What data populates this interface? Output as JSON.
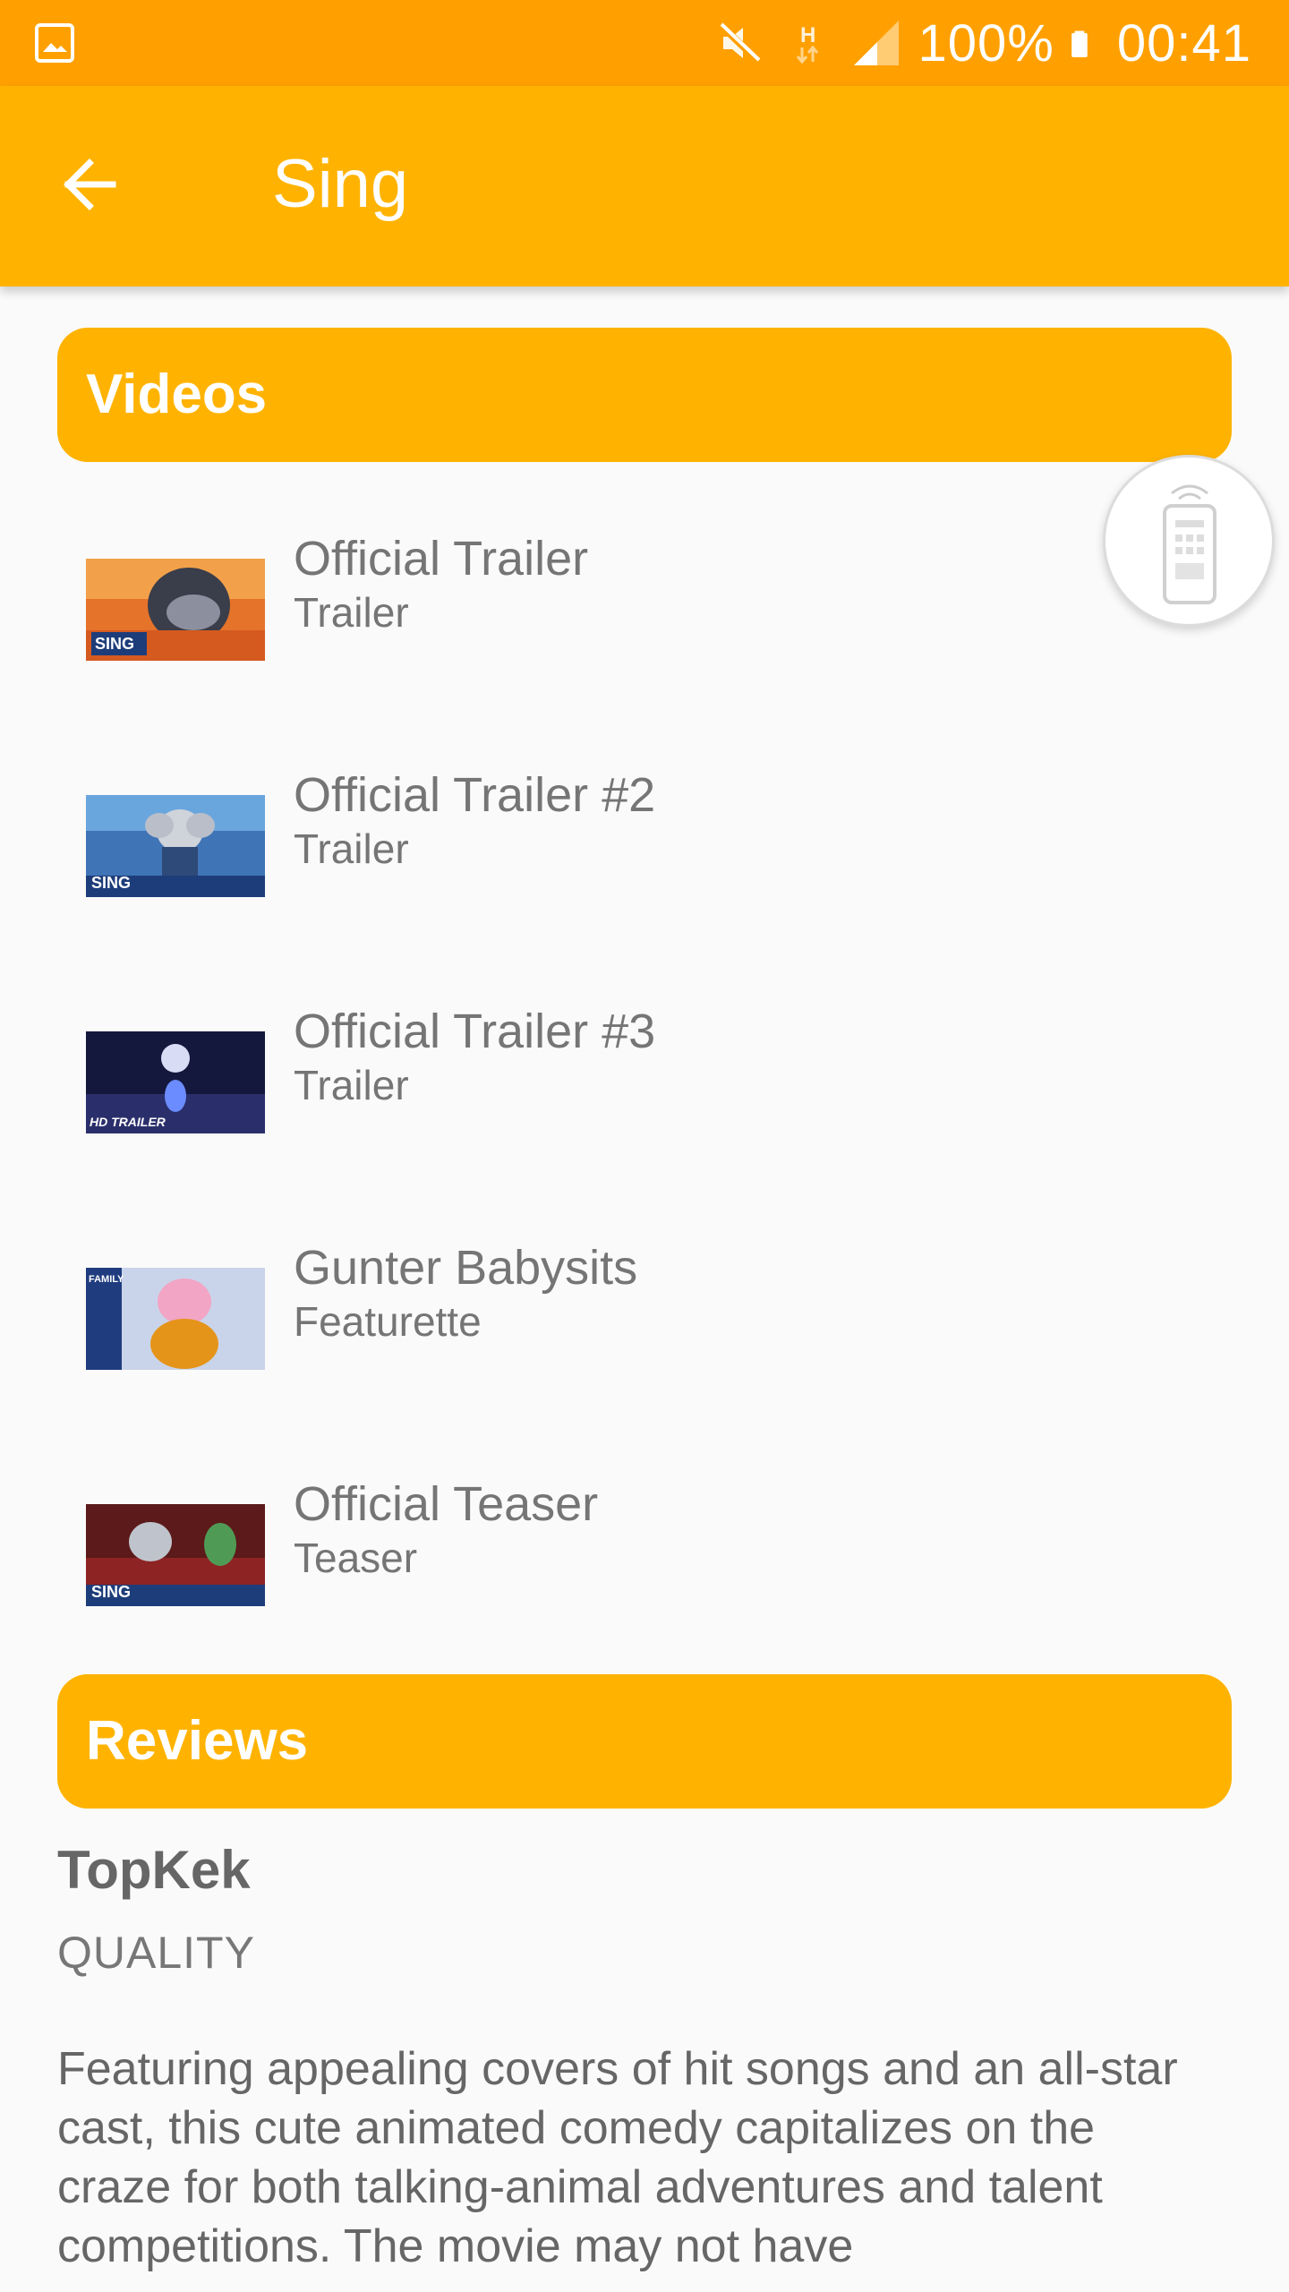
{
  "status_bar": {
    "battery": "100%",
    "time": "00:41"
  },
  "app_bar": {
    "title": "Sing"
  },
  "sections": {
    "videos_label": "Videos",
    "reviews_label": "Reviews"
  },
  "videos": [
    {
      "title": "Official Trailer",
      "type": "Trailer"
    },
    {
      "title": "Official Trailer #2",
      "type": "Trailer"
    },
    {
      "title": "Official Trailer #3",
      "type": "Trailer"
    },
    {
      "title": "Gunter Babysits",
      "type": "Featurette"
    },
    {
      "title": "Official Teaser",
      "type": "Teaser"
    }
  ],
  "review": {
    "author": "TopKek",
    "rating": "QUALITY",
    "text": "Featuring appealing covers of hit songs and an all-star cast, this cute animated comedy capitalizes on the craze for both talking-animal adventures and talent competitions. The movie may not have"
  },
  "icons": {
    "gallery": "image-icon",
    "mute": "mute-icon",
    "network": "h-network-icon",
    "signal": "signal-icon",
    "battery": "battery-icon",
    "back": "arrow-back-icon",
    "remote": "remote-icon"
  },
  "colors": {
    "status_bar": "#ffa000",
    "app_bar": "#ffb300",
    "section_header": "#ffb300",
    "background": "#fafafa"
  }
}
